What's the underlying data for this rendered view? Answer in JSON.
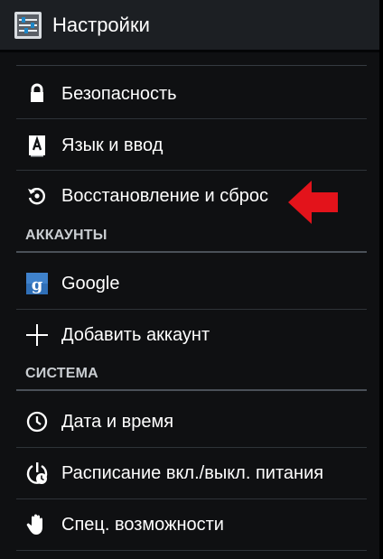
{
  "header": {
    "title": "Настройки",
    "icon": "settings-sliders-icon"
  },
  "items": {
    "security": {
      "label": "Безопасность",
      "icon": "lock-icon"
    },
    "language": {
      "label": "Язык и ввод",
      "icon": "keyboard-a-icon"
    },
    "backup_reset": {
      "label": "Восстановление и сброс",
      "icon": "restore-icon"
    },
    "google": {
      "label": "Google",
      "icon": "google-g-icon"
    },
    "add_account": {
      "label": "Добавить аккаунт",
      "icon": "plus-icon"
    },
    "date_time": {
      "label": "Дата и время",
      "icon": "clock-icon"
    },
    "power_schedule": {
      "label": "Расписание вкл./выкл. питания",
      "icon": "power-schedule-icon"
    },
    "accessibility": {
      "label": "Спец. возможности",
      "icon": "hand-icon"
    }
  },
  "sections": {
    "accounts": "АККАУНТЫ",
    "system": "СИСТЕМА"
  },
  "colors": {
    "background": "#0f1012",
    "action_bar": "#1c1f23",
    "text": "#ffffff",
    "section_text": "#c9cdd1",
    "arrow": "#e3131b",
    "google_blue": "#2f6fb7"
  }
}
